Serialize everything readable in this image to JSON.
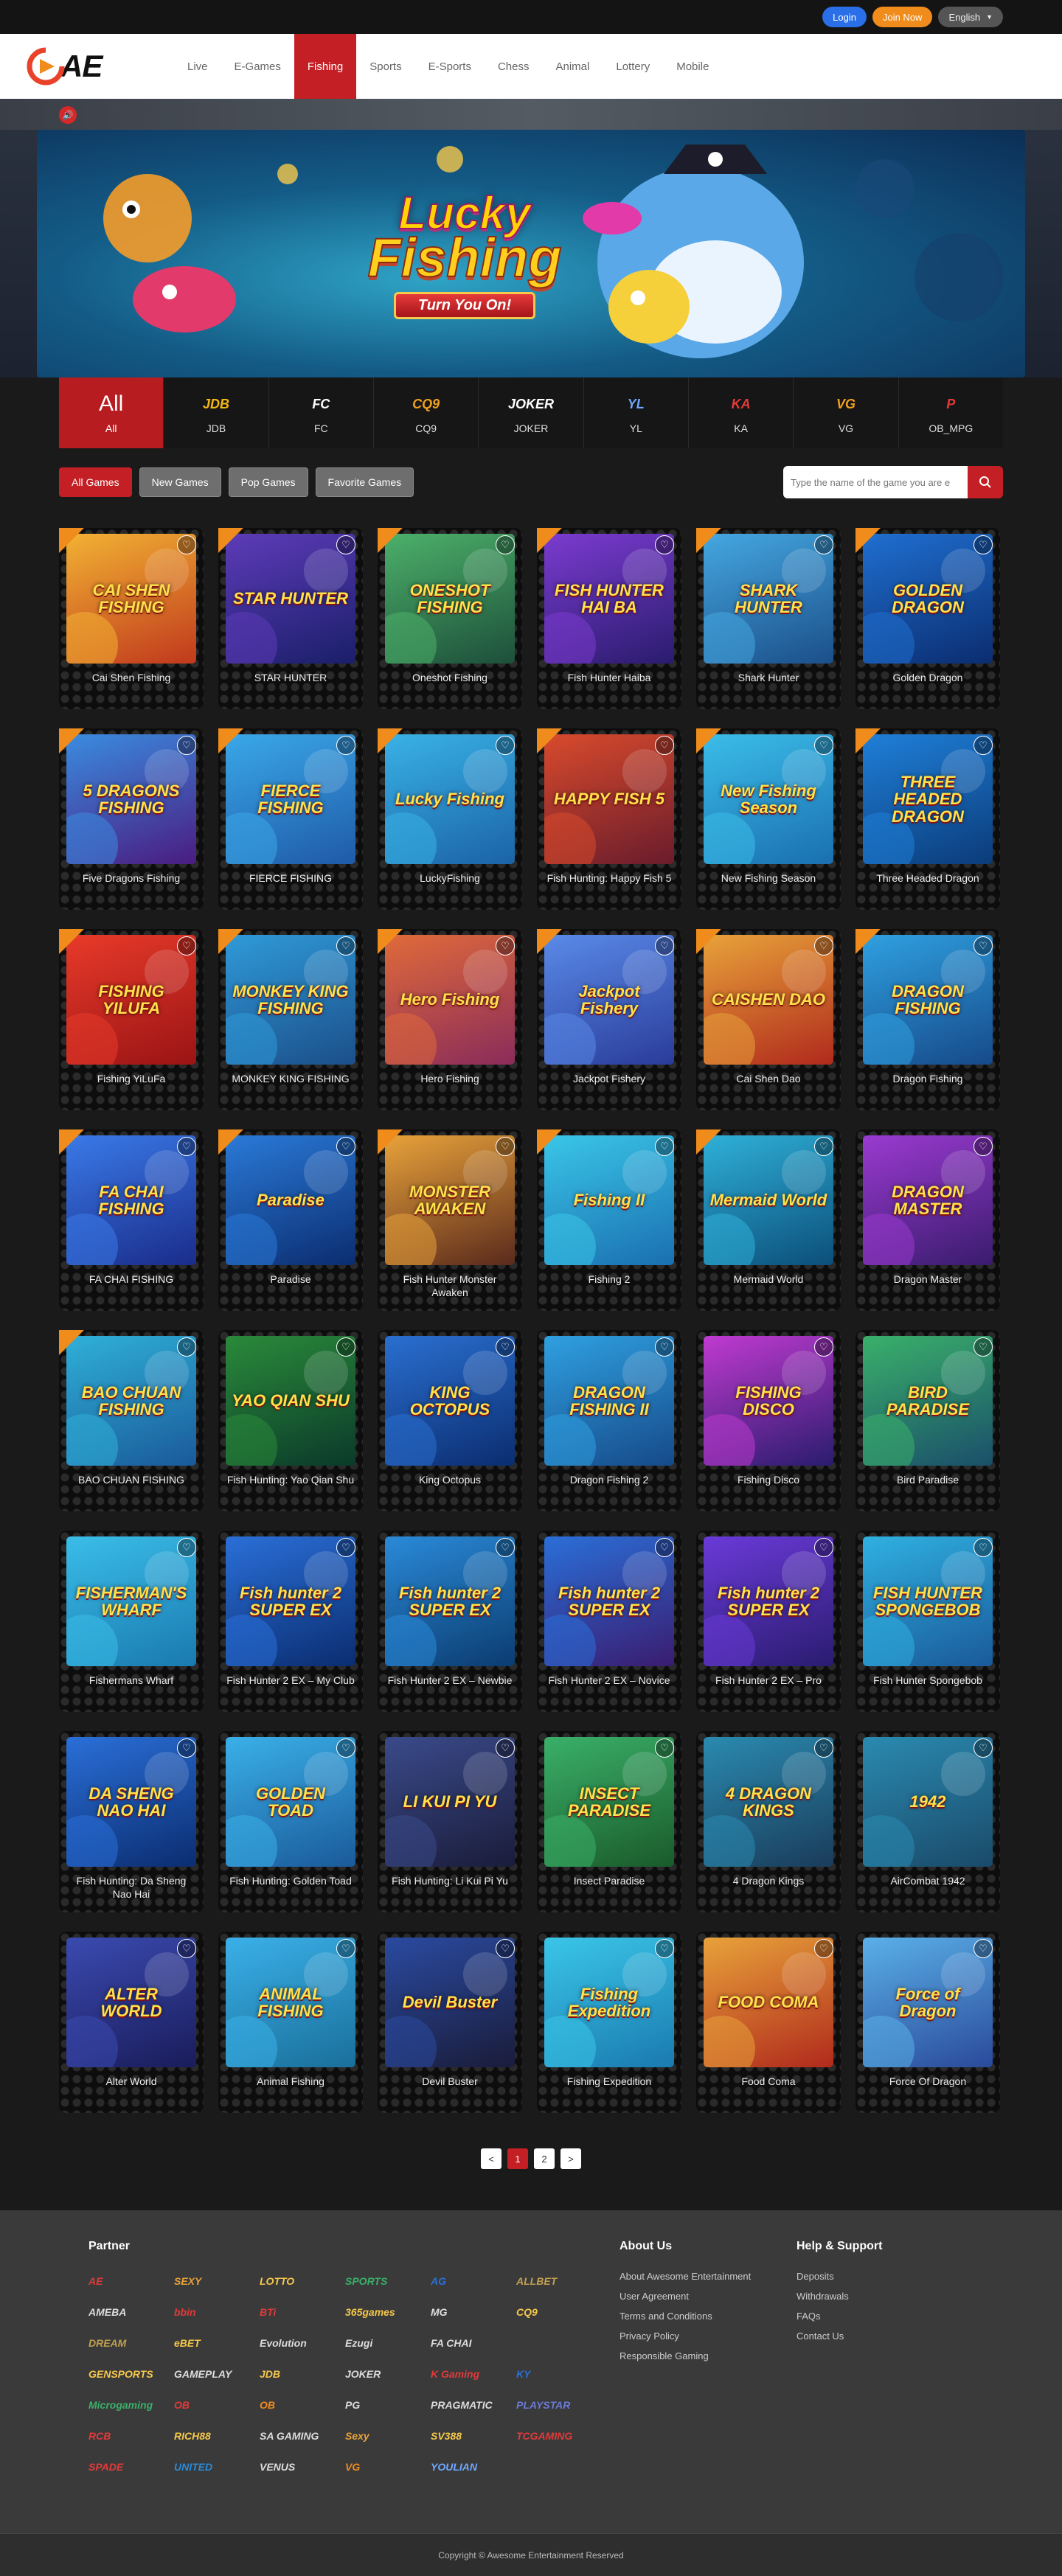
{
  "topbar": {
    "login": "Login",
    "join": "Join Now",
    "language": "English"
  },
  "header": {
    "logo_text": "AE",
    "nav": [
      "Live",
      "E-Games",
      "Fishing",
      "Sports",
      "E-Sports",
      "Chess",
      "Animal",
      "Lottery",
      "Mobile"
    ],
    "active_nav": "Fishing"
  },
  "hero": {
    "title_line1": "Lucky",
    "title_line2": "Fishing",
    "ribbon": "Turn You On!"
  },
  "providers": [
    {
      "logo": "All",
      "name": "All",
      "color": "#ffffff"
    },
    {
      "logo": "JDB",
      "name": "JDB",
      "color": "#f5b915"
    },
    {
      "logo": "FC",
      "name": "FC",
      "color": "#ffffff"
    },
    {
      "logo": "CQ9",
      "name": "CQ9",
      "color": "#f0a020"
    },
    {
      "logo": "JOKER",
      "name": "JOKER",
      "color": "#ffffff"
    },
    {
      "logo": "YL",
      "name": "YL",
      "color": "#6fa8ff"
    },
    {
      "logo": "KA",
      "name": "KA",
      "color": "#e23a3a"
    },
    {
      "logo": "VG",
      "name": "VG",
      "color": "#f0a020"
    },
    {
      "logo": "P",
      "name": "OB_MPG",
      "color": "#e23a3a"
    }
  ],
  "filters": {
    "buttons": [
      "All Games",
      "New Games",
      "Pop Games",
      "Favorite Games"
    ],
    "active": "All Games",
    "search_placeholder": "Type the name of the game you are e"
  },
  "games": [
    {
      "name": "Cai Shen Fishing",
      "art": "CAI SHEN FISHING",
      "bg": [
        "#f2b233",
        "#c0391d"
      ],
      "hot": true
    },
    {
      "name": "STAR HUNTER",
      "art": "STAR HUNTER",
      "bg": [
        "#5d3bb8",
        "#1a1f6a"
      ],
      "hot": true
    },
    {
      "name": "Oneshot Fishing",
      "art": "ONESHOT FISHING",
      "bg": [
        "#4cb06a",
        "#1d4f3a"
      ],
      "hot": true
    },
    {
      "name": "Fish Hunter Haiba",
      "art": "FISH HUNTER HAI BA",
      "bg": [
        "#7b3bd0",
        "#2a1c6e"
      ],
      "hot": true
    },
    {
      "name": "Shark Hunter",
      "art": "SHARK HUNTER",
      "bg": [
        "#45a7e0",
        "#1b4f8a"
      ],
      "hot": true
    },
    {
      "name": "Golden Dragon",
      "art": "GOLDEN DRAGON",
      "bg": [
        "#1f6fd0",
        "#0b2d70"
      ],
      "hot": true
    },
    {
      "name": "Five Dragons Fishing",
      "art": "5 DRAGONS FISHING",
      "bg": [
        "#3a8ce0",
        "#4a1c80"
      ],
      "hot": true
    },
    {
      "name": "FIERCE FISHING",
      "art": "FIERCE FISHING",
      "bg": [
        "#3aa8e8",
        "#1f5aa8"
      ],
      "hot": true
    },
    {
      "name": "LuckyFishing",
      "art": "Lucky Fishing",
      "bg": [
        "#39b2e6",
        "#1b63a6"
      ],
      "hot": true
    },
    {
      "name": "Fish Hunting: Happy Fish 5",
      "art": "HAPPY FISH 5",
      "bg": [
        "#d84a2c",
        "#6a1c2c"
      ],
      "hot": true
    },
    {
      "name": "New Fishing Season",
      "art": "New Fishing Season",
      "bg": [
        "#3bbde8",
        "#1a6fb0"
      ],
      "hot": true
    },
    {
      "name": "Three Headed Dragon",
      "art": "THREE HEADED DRAGON",
      "bg": [
        "#1f7fd8",
        "#0b3c7a"
      ],
      "hot": true
    },
    {
      "name": "Fishing YiLuFa",
      "art": "FISHING YILUFA",
      "bg": [
        "#e83a2a",
        "#9a1414"
      ],
      "hot": true
    },
    {
      "name": "MONKEY KING FISHING",
      "art": "MONKEY KING FISHING",
      "bg": [
        "#2f9ad8",
        "#1b4f8a"
      ],
      "hot": true
    },
    {
      "name": "Hero Fishing",
      "art": "Hero Fishing",
      "bg": [
        "#e06a3a",
        "#8a2c5a"
      ],
      "hot": true
    },
    {
      "name": "Jackpot Fishery",
      "art": "Jackpot Fishery",
      "bg": [
        "#5a8ae8",
        "#2a3c9a"
      ],
      "hot": true
    },
    {
      "name": "Cai Shen Dao",
      "art": "CAISHEN DAO",
      "bg": [
        "#e8a23a",
        "#b02a1c"
      ],
      "hot": true
    },
    {
      "name": "Dragon Fishing",
      "art": "DRAGON FISHING",
      "bg": [
        "#2fa0e0",
        "#164a8a"
      ],
      "hot": true
    },
    {
      "name": "FA CHAI FISHING",
      "art": "FA CHAI FISHING",
      "bg": [
        "#3a7ae8",
        "#1a2c8a"
      ],
      "hot": true
    },
    {
      "name": "Paradise",
      "art": "Paradise",
      "bg": [
        "#2a7ad8",
        "#0b2d70"
      ],
      "hot": true
    },
    {
      "name": "Fish Hunter Monster Awaken",
      "art": "MONSTER AWAKEN",
      "bg": [
        "#e8a23a",
        "#5a2a1c"
      ],
      "hot": true
    },
    {
      "name": "Fishing 2",
      "art": "Fishing II",
      "bg": [
        "#3ac6e8",
        "#1a6fb0"
      ],
      "hot": true
    },
    {
      "name": "Mermaid World",
      "art": "Mermaid World",
      "bg": [
        "#2fb0d8",
        "#0b4f7a"
      ],
      "hot": true
    },
    {
      "name": "Dragon Master",
      "art": "DRAGON MASTER",
      "bg": [
        "#9a3ad0",
        "#3a1c6e"
      ],
      "hot": false
    },
    {
      "name": "BAO CHUAN FISHING",
      "art": "BAO CHUAN FISHING",
      "bg": [
        "#2fb0d8",
        "#1a5a9a"
      ],
      "hot": true
    },
    {
      "name": "Fish Hunting: Yao Qian Shu",
      "art": "YAO QIAN SHU",
      "bg": [
        "#2a8a3a",
        "#0b3a2a"
      ],
      "hot": false
    },
    {
      "name": "King Octopus",
      "art": "KING OCTOPUS",
      "bg": [
        "#2a6fd0",
        "#0b2d70"
      ],
      "hot": false
    },
    {
      "name": "Dragon Fishing 2",
      "art": "DRAGON FISHING II",
      "bg": [
        "#2fa0e0",
        "#164a8a"
      ],
      "hot": false
    },
    {
      "name": "Fishing Disco",
      "art": "FISHING DISCO",
      "bg": [
        "#c03ad0",
        "#2a1c6e"
      ],
      "hot": false
    },
    {
      "name": "Bird Paradise",
      "art": "BIRD PARADISE",
      "bg": [
        "#3ab06a",
        "#1a4f6a"
      ],
      "hot": false
    },
    {
      "name": "Fishermans Wharf",
      "art": "FISHERMAN'S WHARF",
      "bg": [
        "#3abde8",
        "#1a7ab0"
      ],
      "hot": false
    },
    {
      "name": "Fish Hunter 2 EX – My Club",
      "art": "Fish hunter 2 SUPER EX",
      "bg": [
        "#2a6fd8",
        "#0b2d70"
      ],
      "hot": false
    },
    {
      "name": "Fish Hunter 2 EX – Newbie",
      "art": "Fish hunter 2 SUPER EX",
      "bg": [
        "#2a8ad8",
        "#0b3c70"
      ],
      "hot": false
    },
    {
      "name": "Fish Hunter 2 EX – Novice",
      "art": "Fish hunter 2 SUPER EX",
      "bg": [
        "#2a6fd8",
        "#3a1c70"
      ],
      "hot": false
    },
    {
      "name": "Fish Hunter 2 EX – Pro",
      "art": "Fish hunter 2 SUPER EX",
      "bg": [
        "#6a3ad8",
        "#2a1c70"
      ],
      "hot": false
    },
    {
      "name": "Fish Hunter Spongebob",
      "art": "FISH HUNTER SPONGEBOB",
      "bg": [
        "#2fb0e0",
        "#1a5a9a"
      ],
      "hot": false
    },
    {
      "name": "Fish Hunting: Da Sheng Nao Hai",
      "art": "DA SHENG NAO HAI",
      "bg": [
        "#2a6fd8",
        "#0b2d70"
      ],
      "hot": false
    },
    {
      "name": "Fish Hunting: Golden Toad",
      "art": "GOLDEN TOAD",
      "bg": [
        "#3ab0e8",
        "#1a5a9a"
      ],
      "hot": false
    },
    {
      "name": "Fish Hunting: Li Kui Pi Yu",
      "art": "LI KUI PI YU",
      "bg": [
        "#3a4a8a",
        "#1a1c3a"
      ],
      "hot": false
    },
    {
      "name": "Insect Paradise",
      "art": "INSECT PARADISE",
      "bg": [
        "#3ab06a",
        "#1a5a2a"
      ],
      "hot": false
    },
    {
      "name": "4 Dragon Kings",
      "art": "4 DRAGON KINGS",
      "bg": [
        "#2a8ab0",
        "#1a3c5a"
      ],
      "hot": false
    },
    {
      "name": "AirCombat 1942",
      "art": "1942",
      "bg": [
        "#2a8ab0",
        "#1a4a6a"
      ],
      "hot": false
    },
    {
      "name": "Alter World",
      "art": "ALTER WORLD",
      "bg": [
        "#3a4ab0",
        "#1a1c5a"
      ],
      "hot": false
    },
    {
      "name": "Animal Fishing",
      "art": "ANIMAL FISHING",
      "bg": [
        "#3ab0e8",
        "#1a6f9a"
      ],
      "hot": false
    },
    {
      "name": "Devil Buster",
      "art": "Devil Buster",
      "bg": [
        "#2a4aa0",
        "#1a1c3a"
      ],
      "hot": false
    },
    {
      "name": "Fishing Expedition",
      "art": "Fishing Expedition",
      "bg": [
        "#3ac6e8",
        "#1a7ab0"
      ],
      "hot": false
    },
    {
      "name": "Food Coma",
      "art": "FOOD COMA",
      "bg": [
        "#e8a23a",
        "#b02a1c"
      ],
      "hot": false
    },
    {
      "name": "Force Of Dragon",
      "art": "Force of Dragon",
      "bg": [
        "#5ab0e8",
        "#2a4a9a"
      ],
      "hot": false
    }
  ],
  "pagination": {
    "prev": "<",
    "pages": [
      "1",
      "2"
    ],
    "active": "1",
    "next": ">"
  },
  "footer": {
    "partner_title": "Partner",
    "partner_logos": [
      "AE",
      "SEXY",
      "LOTTO",
      "SPORTS",
      "AG",
      "ALLBET",
      "AMEBA",
      "bbin",
      "BTi",
      "365games",
      "MG",
      "CQ9",
      "DREAM",
      "eBET",
      "Evolution",
      "Ezugi",
      "FA CHAI",
      "",
      "GENSPORTS",
      "GAMEPLAY",
      "JDB",
      "JOKER",
      "K Gaming",
      "KY",
      "Microgaming",
      "OB",
      "OB",
      "PG",
      "PRAGMATIC",
      "PLAYSTAR",
      "RCB",
      "RICH88",
      "SA GAMING",
      "Sexy",
      "SV388",
      "TCGAMING",
      "SPADE",
      "UNITED",
      "VENUS",
      "VG",
      "YOULIAN",
      ""
    ],
    "about_title": "About Us",
    "about_links": [
      "About Awesome Entertainment",
      "User Agreement",
      "Terms and Conditions",
      "Privacy Policy",
      "Responsible Gaming"
    ],
    "help_title": "Help & Support",
    "help_links": [
      "Deposits",
      "Withdrawals",
      "FAQs",
      "Contact Us"
    ],
    "copyright": "Copyright © Awesome Entertainment Reserved"
  },
  "colors": {
    "accent": "#c31f24",
    "login": "#2a6fe8",
    "join": "#f08c1b",
    "page_bg": "#1a1a1a",
    "footer_bg": "#3a3a3a"
  }
}
